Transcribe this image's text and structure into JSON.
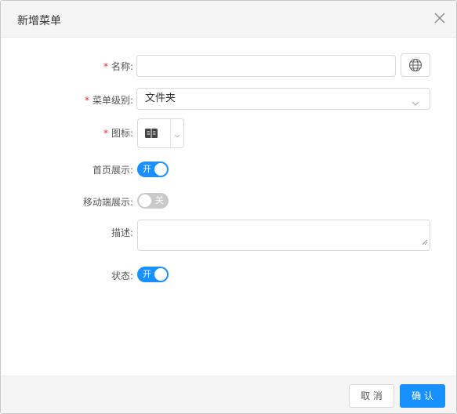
{
  "dialog": {
    "title": "新增菜单",
    "close_icon": "close-icon"
  },
  "form": {
    "name": {
      "label": "名称:",
      "required_mark": "*",
      "value": ""
    },
    "menu_level": {
      "label": "菜单级别:",
      "required_mark": "*",
      "value": "文件夹"
    },
    "icon": {
      "label": "图标:",
      "required_mark": "*",
      "selected_icon": "book-icon"
    },
    "homepage_display": {
      "label": "首页展示:",
      "state_text": "开",
      "on": true
    },
    "mobile_display": {
      "label": "移动端展示:",
      "state_text": "关",
      "on": false
    },
    "description": {
      "label": "描述:",
      "value": ""
    },
    "status": {
      "label": "状态:",
      "state_text": "开",
      "on": true
    }
  },
  "footer": {
    "cancel_label": "取 消",
    "ok_label": "确 认"
  },
  "colors": {
    "primary": "#1890ff",
    "required": "#f5222d",
    "switch_off": "#c9c9c9"
  }
}
